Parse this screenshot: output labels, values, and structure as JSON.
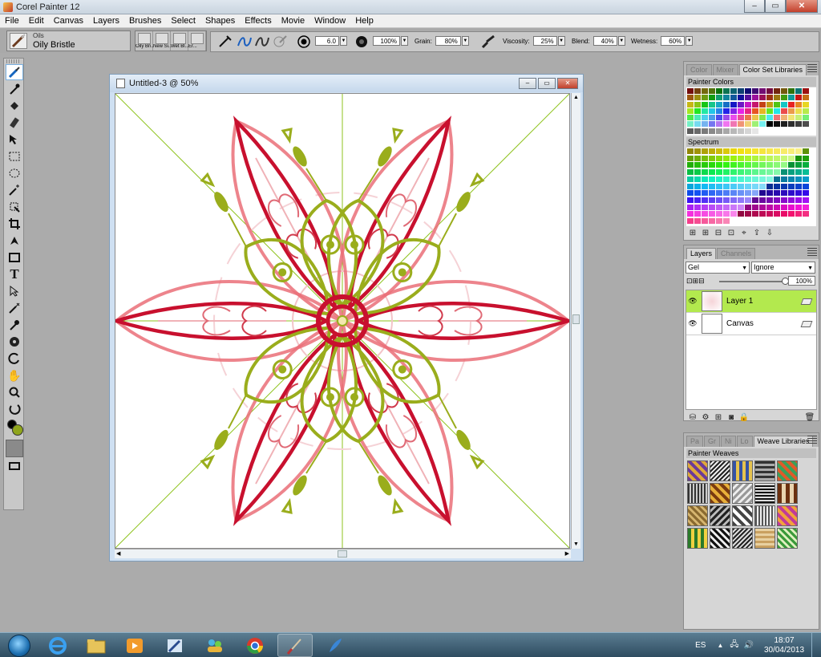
{
  "app": {
    "title": "Corel Painter 12",
    "window_buttons": {
      "minimize": "–",
      "maximize": "▭",
      "close": "✕"
    }
  },
  "menu": [
    "File",
    "Edit",
    "Canvas",
    "Layers",
    "Brushes",
    "Select",
    "Shapes",
    "Effects",
    "Movie",
    "Window",
    "Help"
  ],
  "property_bar": {
    "brush_category": "Oils",
    "brush_variant": "Oily Bristle",
    "recent_brushes": [
      "Oily Bri...",
      "New Si...",
      "Wet Bl...",
      "Er..."
    ],
    "size": "6.0",
    "opacity": "100%",
    "grain_label": "Grain:",
    "grain": "80%",
    "viscosity_label": "Viscosity:",
    "viscosity": "25%",
    "blend_label": "Blend:",
    "blend": "40%",
    "wetness_label": "Wetness:",
    "wetness": "60%"
  },
  "toolbox": {
    "tools": [
      "brush-tool",
      "dropper-tool",
      "paint-bucket-tool",
      "eraser-tool",
      "layer-adjuster-tool",
      "rectangular-selection-tool",
      "oval-selection-tool",
      "magic-wand-tool",
      "transform-tool",
      "crop-tool",
      "pen-tool",
      "rectangle-shape-tool",
      "text-tool",
      "shape-selection-tool",
      "divine-proportion-tool",
      "cloner-tool",
      "kaleidoscope-tool",
      "rotate-page-tool",
      "grabber-tool",
      "magnifier-tool",
      "rotate-tool"
    ],
    "main_color": "#8fa51c",
    "additional_color": "#000000"
  },
  "document": {
    "title": "Untitled-3 @ 50%"
  },
  "color_panel": {
    "tabs": [
      "Color",
      "Mixer",
      "Color Set Libraries"
    ],
    "painter_colors_label": "Painter Colors",
    "spectrum_label": "Spectrum"
  },
  "layers_panel": {
    "tabs": [
      "Layers",
      "Channels"
    ],
    "composite_method": "Gel",
    "preserve": "Ignore",
    "opacity": "100%",
    "layers": [
      {
        "name": "Layer 1",
        "selected": true
      },
      {
        "name": "Canvas",
        "selected": false
      }
    ]
  },
  "weaves_panel": {
    "tabs": [
      "Pa",
      "Gr",
      "Ni",
      "Lo",
      "Weave Libraries"
    ],
    "library_label": "Painter Weaves"
  },
  "taskbar": {
    "language": "ES",
    "time": "18:07",
    "date": "30/04/2013"
  }
}
